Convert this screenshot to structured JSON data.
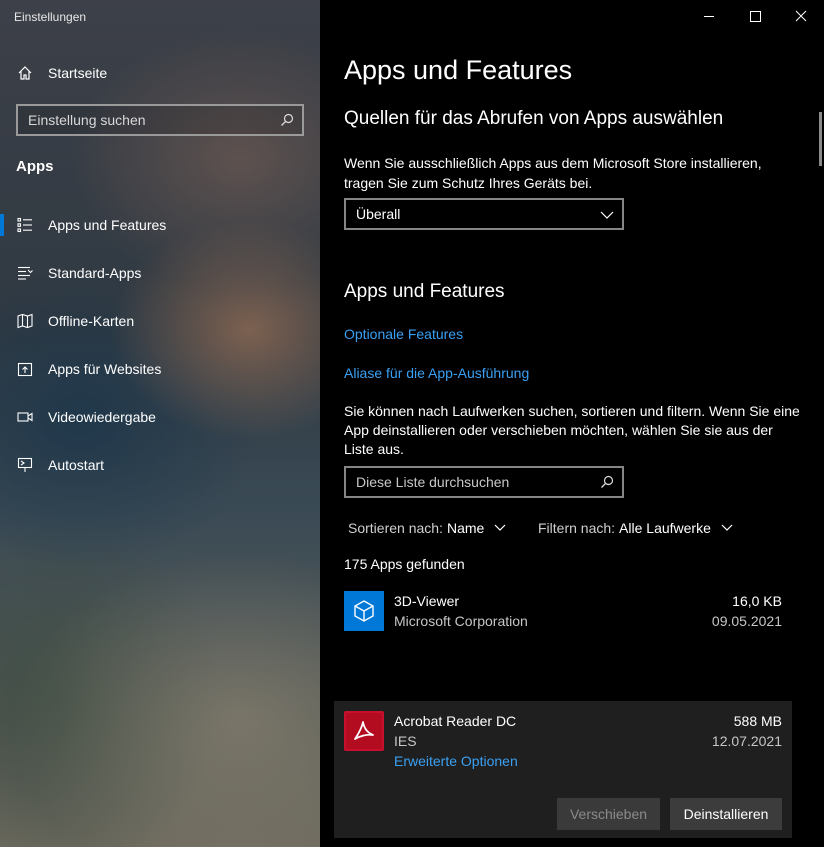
{
  "window": {
    "title": "Einstellungen"
  },
  "sidebar": {
    "home_label": "Startseite",
    "search_placeholder": "Einstellung suchen",
    "section_heading": "Apps",
    "items": [
      {
        "label": "Apps und Features",
        "icon": "apps-features-icon",
        "selected": true
      },
      {
        "label": "Standard-Apps",
        "icon": "default-apps-icon",
        "selected": false
      },
      {
        "label": "Offline-Karten",
        "icon": "offline-maps-icon",
        "selected": false
      },
      {
        "label": "Apps für Websites",
        "icon": "apps-websites-icon",
        "selected": false
      },
      {
        "label": "Videowiedergabe",
        "icon": "video-playback-icon",
        "selected": false
      },
      {
        "label": "Autostart",
        "icon": "startup-icon",
        "selected": false
      }
    ]
  },
  "main": {
    "title": "Apps und Features",
    "sources": {
      "heading": "Quellen für das Abrufen von Apps auswählen",
      "description": "Wenn Sie ausschließlich Apps aus dem Microsoft Store installieren, tragen Sie zum Schutz Ihres Geräts bei.",
      "selected": "Überall"
    },
    "apps_features": {
      "heading": "Apps und Features",
      "link_optional": "Optionale Features",
      "link_aliases": "Aliase für die App-Ausführung",
      "description": "Sie können nach Laufwerken suchen, sortieren und filtern. Wenn Sie eine App deinstallieren oder verschieben möchten, wählen Sie sie aus der Liste aus.",
      "search_placeholder": "Diese Liste durchsuchen",
      "sort_label": "Sortieren nach:",
      "sort_value": "Name",
      "filter_label": "Filtern nach:",
      "filter_value": "Alle Laufwerke",
      "count_text": "175 Apps gefunden"
    },
    "apps": [
      {
        "name": "3D-Viewer",
        "publisher": "Microsoft Corporation",
        "size": "16,0 KB",
        "date": "09.05.2021",
        "icon": "3d-viewer-icon"
      },
      {
        "name": "Acrobat Reader DC",
        "publisher": "IES",
        "size": "588 MB",
        "date": "12.07.2021",
        "icon": "acrobat-icon",
        "advanced_link": "Erweiterte Optionen",
        "move_label": "Verschieben",
        "uninstall_label": "Deinstallieren"
      }
    ]
  },
  "colors": {
    "accent": "#0078d7",
    "link": "#3aa0f3",
    "background": "#000000",
    "selected_item_bg": "#1f1f1f",
    "app_tile": "#0078d7",
    "acrobat_red": "#c8102e"
  }
}
